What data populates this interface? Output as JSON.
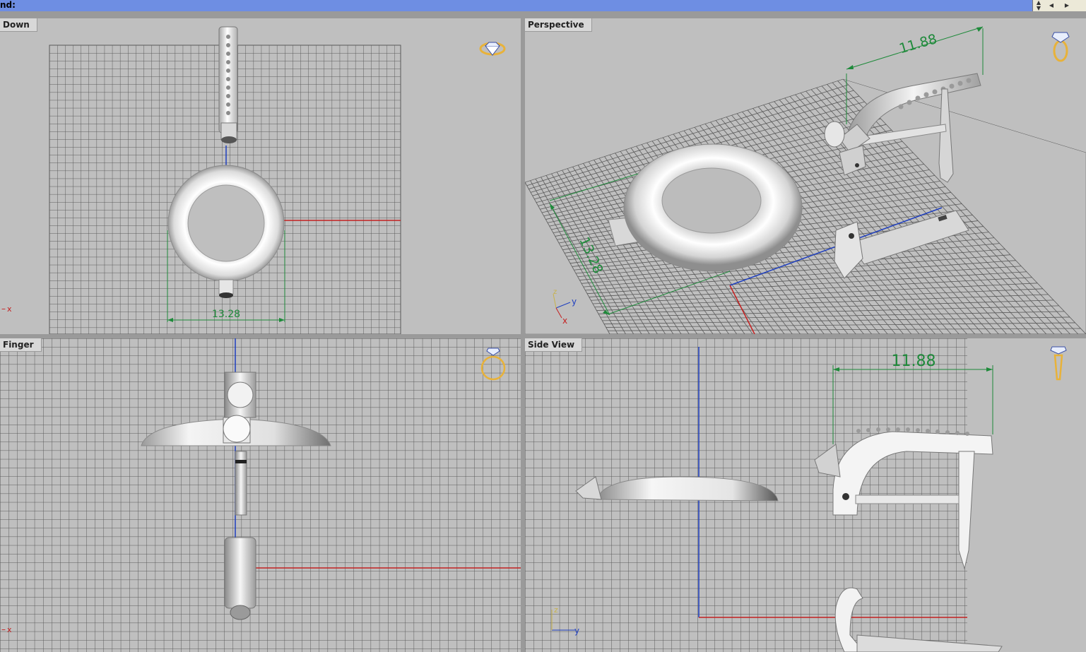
{
  "command": {
    "label": "nd:"
  },
  "scroll": {
    "up": "▲",
    "down": "▼",
    "left": "◀",
    "right": "▶"
  },
  "viewports": {
    "top_left": {
      "title": "Down",
      "dimension": "13.28",
      "axis_label": "x"
    },
    "top_right": {
      "title": "Perspective",
      "dimension_a": "11.88",
      "dimension_b": "13.28",
      "axis_y": "y",
      "axis_x": "x",
      "axis_z": "z"
    },
    "bottom_left": {
      "title": "Finger",
      "axis_label": "x"
    },
    "bottom_right": {
      "title": "Side View",
      "dimension": "11.88",
      "axis_z": "z",
      "axis_y": "y"
    }
  },
  "icons": {
    "top_left": "diamond-gem-icon",
    "top_right": "ring-side-icon",
    "bottom_left": "ring-front-icon",
    "bottom_right": "gem-side-icon"
  },
  "colors": {
    "grid_line": "#5a5a5a",
    "axis_red": "#c42020",
    "axis_blue": "#1f3fbf",
    "dimension": "#1e8a3a",
    "icon_gold": "#e8b23a",
    "titlebar": "#6e8ee3"
  }
}
